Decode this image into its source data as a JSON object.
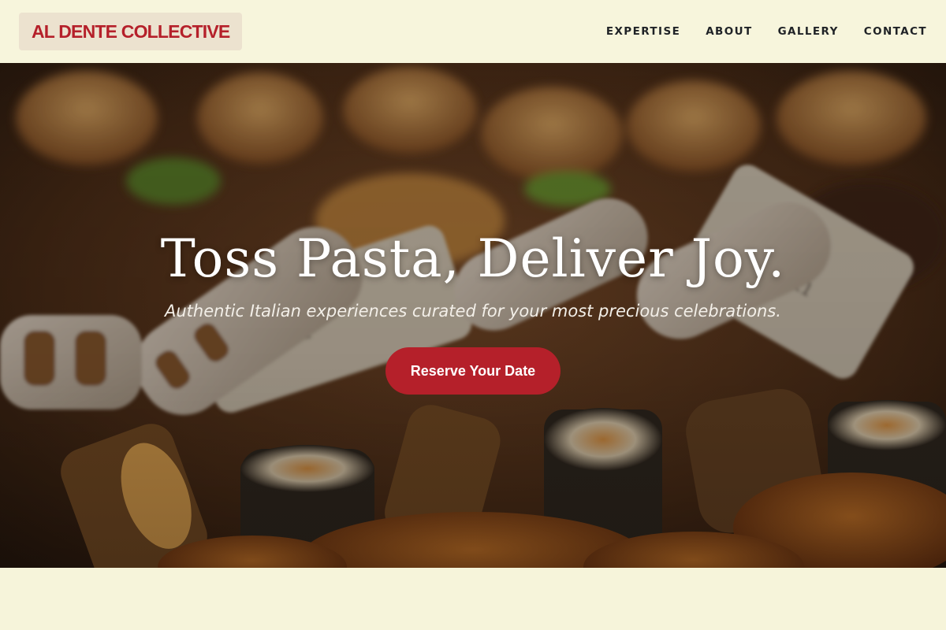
{
  "brand": {
    "name": "AL DENTE COLLECTIVE"
  },
  "nav": {
    "items": [
      "EXPERTISE",
      "ABOUT",
      "GALLERY",
      "CONTACT"
    ]
  },
  "hero": {
    "title": "Toss Pasta, Deliver Joy.",
    "subtitle": "Authentic Italian experiences curated for your most precious celebrations.",
    "cta_label": "Reserve Your Date",
    "image_alt": "food-platter-background"
  },
  "colors": {
    "brand_red": "#b5202a",
    "header_bg": "#f7f5dc",
    "logo_bg": "#ece2cf",
    "page_bg": "#f6f4da"
  }
}
